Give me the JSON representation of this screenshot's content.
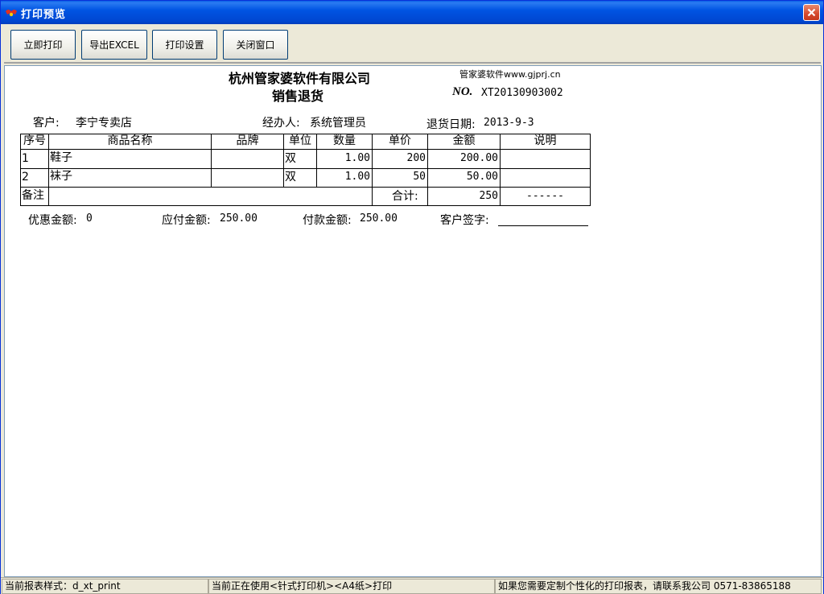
{
  "window": {
    "title": "打印预览",
    "close_icon": "close-icon"
  },
  "toolbar": {
    "print_now": "立即打印",
    "export_excel": "导出EXCEL",
    "print_setup": "打印设置",
    "close_window": "关闭窗口"
  },
  "document": {
    "company": "杭州管家婆软件有限公司",
    "doc_type": "销售退货",
    "website": "管家婆软件www.gjprj.cn",
    "no_label": "NO.",
    "no_value": "XT20130903002",
    "customer_label": "客户:",
    "customer_value": "李宁专卖店",
    "handler_label": "经办人:",
    "handler_value": "系统管理员",
    "return_date_label": "退货日期:",
    "return_date_value": "2013-9-3",
    "columns": [
      "序号",
      "商品名称",
      "品牌",
      "单位",
      "数量",
      "单价",
      "金额",
      "说明"
    ],
    "rows": [
      {
        "seq": "1",
        "name": "鞋子",
        "brand": "",
        "unit": "双",
        "qty": "1.00",
        "price": "200",
        "amount": "200.00",
        "note": ""
      },
      {
        "seq": "2",
        "name": "袜子",
        "brand": "",
        "unit": "双",
        "qty": "1.00",
        "price": "50",
        "amount": "50.00",
        "note": ""
      }
    ],
    "remark_label": "备注",
    "total_label": "合计:",
    "total_value": "250",
    "total_note": "------",
    "discount_label": "优惠金额:",
    "discount_value": "0",
    "payable_label": "应付金额:",
    "payable_value": "250.00",
    "paid_label": "付款金额:",
    "paid_value": "250.00",
    "signature_label": "客户签字:"
  },
  "status": {
    "style": "当前报表样式：d_xt_print",
    "printer": "当前正在使用<针式打印机><A4纸>打印",
    "contact": "如果您需要定制个性化的打印报表，请联系我公司 0571-83865188"
  }
}
